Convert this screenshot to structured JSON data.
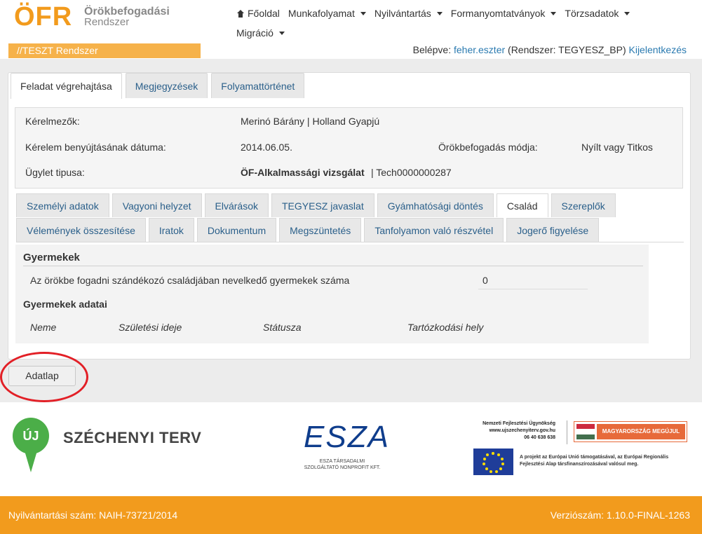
{
  "header": {
    "logo_text": "ÖFR",
    "logo_line1": "Örökbefogadási",
    "logo_line2": "Rendszer",
    "system_label": "//TESZT Rendszer",
    "nav": {
      "home": "Főoldal",
      "items": [
        "Munkafolyamat",
        "Nyilvántartás",
        "Formanyomtatványok",
        "Törzsadatok",
        "Migráció"
      ]
    },
    "login": {
      "label": "Belépve:",
      "user": "feher.eszter",
      "system": "(Rendszer: TEGYESZ_BP)",
      "logout": "Kijelentkezés"
    }
  },
  "top_tabs": [
    "Feladat végrehajtása",
    "Megjegyzések",
    "Folyamattörténet"
  ],
  "info": {
    "requesters_label": "Kérelmezők:",
    "requesters_value": "Merinó Bárány | Holland Gyapjú",
    "date_label": "Kérelem benyújtásának dátuma:",
    "date_value": "2014.06.05.",
    "mode_label": "Örökbefogadás módja:",
    "mode_value": "Nyílt vagy Titkos",
    "type_label": "Ügylet tipusa:",
    "type_value_bold": "ÖF-Alkalmassági vizsgálat",
    "type_value_rest": "| Tech0000000287"
  },
  "sub_tabs_row1": [
    "Személyi adatok",
    "Vagyoni helyzet",
    "Elvárások",
    "TEGYESZ javaslat",
    "Gyámhatósági döntés",
    "Család",
    "Szereplők"
  ],
  "sub_tabs_row2": [
    "Vélemények összesítése",
    "Iratok",
    "Dokumentum",
    "Megszüntetés",
    "Tanfolyamon való részvétel",
    "Jogerő figyelése"
  ],
  "content": {
    "heading": "Gyermekek",
    "question": "Az örökbe fogadni szándékozó családjában nevelkedő gyermekek száma",
    "answer": "0",
    "subheading": "Gyermekek adatai",
    "columns": [
      "Neme",
      "Születési ideje",
      "Státusza",
      "Tartózkodási hely"
    ]
  },
  "button_adatlap": "Adatlap",
  "logos": {
    "szechenyi_pin": "ÚJ",
    "szechenyi": "SZÉCHENYI TERV",
    "esza": "ESZA",
    "esza_sub": "ESZA TÁRSADALMI SZOLGÁLTATÓ NONPROFIT KFT.",
    "nfu_line1": "Nemzeti Fejlesztési Ügynökség",
    "nfu_line2": "www.ujszechenyiterv.gov.hu",
    "nfu_line3": "06 40 638 638",
    "magyar": "MAGYARORSZÁG MEGÚJUL",
    "eu_text": "A projekt az Európai Unió támogatásával, az Európai Regionális Fejlesztési Alap társfinanszírozásával valósul meg."
  },
  "footer": {
    "left": "Nyilvántartási szám: NAIH-73721/2014",
    "right": "Verziószám: 1.10.0-FINAL-1263"
  },
  "colors": {
    "brand_orange": "#f29b1d",
    "link_blue": "#2a7ab0",
    "highlight_red": "#e21f26"
  }
}
